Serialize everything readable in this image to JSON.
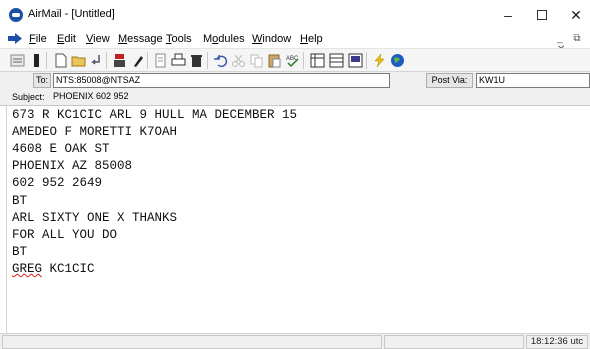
{
  "window": {
    "title": "AirMail - [Untitled]",
    "minimize": "–",
    "close": "✕"
  },
  "menu": {
    "items": [
      {
        "pre": "",
        "u": "F",
        "post": "ile"
      },
      {
        "pre": "",
        "u": "E",
        "post": "dit"
      },
      {
        "pre": "",
        "u": "V",
        "post": "iew"
      },
      {
        "pre": "",
        "u": "M",
        "post": "essage"
      },
      {
        "pre": "",
        "u": "T",
        "post": "ools"
      },
      {
        "pre": "M",
        "u": "o",
        "post": "dules"
      },
      {
        "pre": "",
        "u": "W",
        "post": "indow"
      },
      {
        "pre": "",
        "u": "H",
        "post": "elp"
      }
    ],
    "mdi_controls": "_ ⧉ ✕"
  },
  "toolbar": {
    "icons": [
      "list-icon",
      "bookmark-icon",
      "new-document-icon",
      "open-folder-icon",
      "reply-icon",
      "send-icon",
      "attach-icon",
      "print-preview-icon",
      "print-icon",
      "delete-icon",
      "undo-icon",
      "cut-icon",
      "copy-icon",
      "paste-icon",
      "spellcheck-icon",
      "grid-1-icon",
      "grid-2-icon",
      "grid-3-icon",
      "lightning-icon",
      "globe-icon"
    ]
  },
  "address": {
    "to_label": "To:",
    "to_value": "NTS:85008@NTSAZ",
    "postvia_label": "Post Via:",
    "postvia_value": "KW1U",
    "subject_label": "Subject:",
    "subject_value": "PHOENIX 602 952"
  },
  "body": {
    "lines": [
      "673 R KC1CIC ARL 9 HULL MA DECEMBER 15",
      "AMEDEO F MORETTI K7OAH",
      "4608 E OAK ST",
      "PHOENIX AZ 85008",
      "602 952 2649",
      "BT",
      "ARL SIXTY ONE X THANKS",
      "FOR ALL YOU DO",
      "BT"
    ],
    "signature_name": "GREG",
    "signature_call": " KC1CIC"
  },
  "status": {
    "time": "18:12:36 utc"
  },
  "colors": {
    "app_icon": "#1e4fa6",
    "spell_underline": "#d02020",
    "lightning": "#f0c000",
    "globe": "#1e5bbf"
  }
}
